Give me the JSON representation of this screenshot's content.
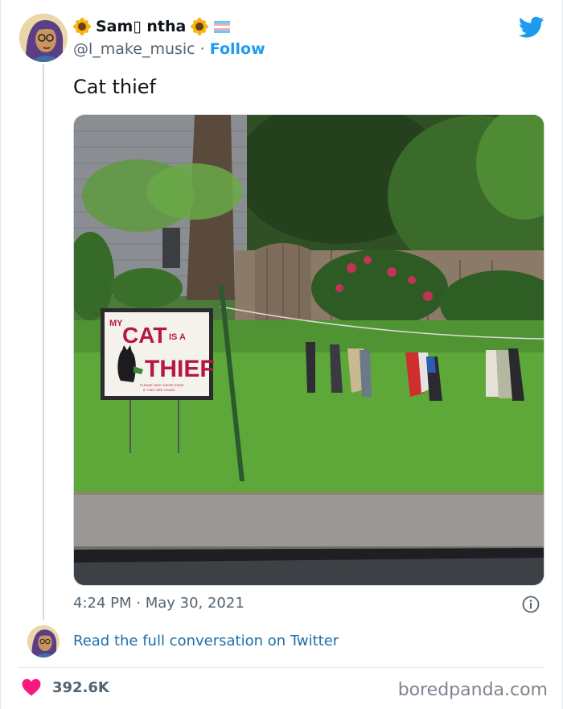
{
  "tweet": {
    "author_name": "Sam▯ ntha",
    "author_handle": "@l_make_music",
    "separator": "·",
    "follow_label": "Follow",
    "text": "Cat thief",
    "timestamp": "4:24 PM · May 30, 2021",
    "read_more_label": "Read the full conversation on Twitter",
    "likes_count": "392.6K"
  },
  "photo_sign": {
    "line_my": "MY",
    "line_cat": "CAT",
    "line_is_a": "IS A",
    "line_thief": "THIEF",
    "small_text_1": "PLEASE TAKE THESE ITEMS",
    "small_text_2": "IF THEY ARE YOURS"
  },
  "watermark": "boredpanda.com",
  "colors": {
    "twitter_blue": "#1d9bf0",
    "heart_pink": "#f91880",
    "link_blue": "#1d6fa8",
    "sign_red": "#b5193f"
  },
  "icons": {
    "sunflower": "sunflower-icon",
    "flag": "transgender-flag-icon",
    "twitter": "twitter-bird-icon",
    "info": "info-icon",
    "heart": "heart-icon"
  }
}
